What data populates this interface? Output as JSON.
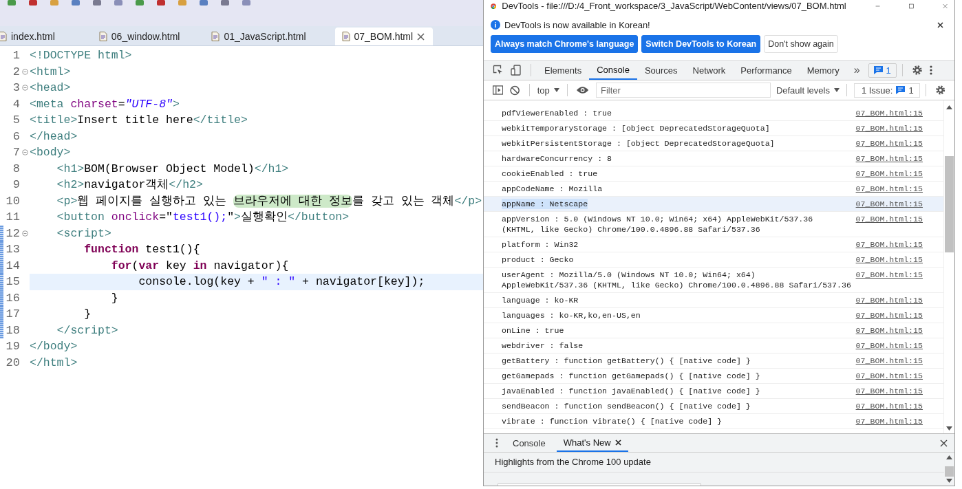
{
  "ide": {
    "editor_tabs": [
      {
        "label": "index.html",
        "selected": false,
        "closable": false
      },
      {
        "label": "06_window.html",
        "selected": false,
        "closable": false
      },
      {
        "label": "01_JavaScript.html",
        "selected": false,
        "closable": false
      },
      {
        "label": "07_BOM.html",
        "selected": true,
        "closable": true
      }
    ],
    "code_lines": [
      {
        "number": "1",
        "foldable": false,
        "changed": false,
        "current": false,
        "tokens": [
          {
            "kind": "tag",
            "text": "<!DOCTYPE html>"
          }
        ]
      },
      {
        "number": "2",
        "foldable": true,
        "changed": false,
        "current": false,
        "tokens": [
          {
            "kind": "tag",
            "text": "<html>"
          }
        ]
      },
      {
        "number": "3",
        "foldable": true,
        "changed": false,
        "current": false,
        "tokens": [
          {
            "kind": "tag",
            "text": "<head>"
          }
        ]
      },
      {
        "number": "4",
        "foldable": false,
        "changed": false,
        "current": false,
        "tokens": [
          {
            "kind": "tag",
            "text": "<meta "
          },
          {
            "kind": "attr",
            "text": "charset"
          },
          {
            "kind": "text",
            "text": "="
          },
          {
            "kind": "value",
            "text": "\"UTF-8\""
          },
          {
            "kind": "tag",
            "text": ">"
          }
        ]
      },
      {
        "number": "5",
        "foldable": false,
        "changed": false,
        "current": false,
        "tokens": [
          {
            "kind": "tag",
            "text": "<title>"
          },
          {
            "kind": "text",
            "text": "Insert title here"
          },
          {
            "kind": "tag",
            "text": "</title>"
          }
        ]
      },
      {
        "number": "6",
        "foldable": false,
        "changed": false,
        "current": false,
        "tokens": [
          {
            "kind": "tag",
            "text": "</head>"
          }
        ]
      },
      {
        "number": "7",
        "foldable": true,
        "changed": false,
        "current": false,
        "tokens": [
          {
            "kind": "tag",
            "text": "<body>"
          }
        ]
      },
      {
        "number": "8",
        "foldable": false,
        "changed": false,
        "current": false,
        "tokens": [
          {
            "kind": "tag",
            "text": "    <h1>"
          },
          {
            "kind": "text",
            "text": "BOM(Browser Object Model)"
          },
          {
            "kind": "tag",
            "text": "</h1>"
          }
        ]
      },
      {
        "number": "9",
        "foldable": false,
        "changed": false,
        "current": false,
        "tokens": [
          {
            "kind": "tag",
            "text": "    <h2>"
          },
          {
            "kind": "text",
            "text": "navigator객체"
          },
          {
            "kind": "tag",
            "text": "</h2>"
          }
        ]
      },
      {
        "number": "10",
        "foldable": false,
        "changed": false,
        "current": false,
        "tokens": [
          {
            "kind": "tag",
            "text": "    <p>"
          },
          {
            "kind": "text",
            "text": "웹 페이지를 실행하고 있는 "
          },
          {
            "kind": "match",
            "text": "브라우저에 대한 정보"
          },
          {
            "kind": "text",
            "text": "를 갖고 있는 객체"
          },
          {
            "kind": "tag",
            "text": "</p>"
          }
        ]
      },
      {
        "number": "11",
        "foldable": false,
        "changed": false,
        "current": false,
        "tokens": [
          {
            "kind": "tag",
            "text": "    <button "
          },
          {
            "kind": "attr",
            "text": "onclick"
          },
          {
            "kind": "text",
            "text": "=\""
          },
          {
            "kind": "string",
            "text": "test1();"
          },
          {
            "kind": "text",
            "text": "\""
          },
          {
            "kind": "tag",
            "text": ">"
          },
          {
            "kind": "text",
            "text": "실행확인"
          },
          {
            "kind": "tag",
            "text": "</button>"
          }
        ]
      },
      {
        "number": "12",
        "foldable": true,
        "changed": true,
        "current": false,
        "tokens": [
          {
            "kind": "tag",
            "text": "    <script>"
          }
        ]
      },
      {
        "number": "13",
        "foldable": false,
        "changed": true,
        "current": false,
        "tokens": [
          {
            "kind": "keyword",
            "text": "        function"
          },
          {
            "kind": "text",
            "text": " test1(){"
          }
        ]
      },
      {
        "number": "14",
        "foldable": false,
        "changed": true,
        "current": false,
        "tokens": [
          {
            "kind": "keyword",
            "text": "            for"
          },
          {
            "kind": "text",
            "text": "("
          },
          {
            "kind": "keyword",
            "text": "var"
          },
          {
            "kind": "text",
            "text": " key "
          },
          {
            "kind": "keyword",
            "text": "in"
          },
          {
            "kind": "text",
            "text": " navigator){"
          }
        ]
      },
      {
        "number": "15",
        "foldable": false,
        "changed": true,
        "current": true,
        "tokens": [
          {
            "kind": "text",
            "text": "                console.log(key + "
          },
          {
            "kind": "string",
            "text": "\" : \""
          },
          {
            "kind": "text",
            "text": " + navigator[key]);"
          }
        ]
      },
      {
        "number": "16",
        "foldable": false,
        "changed": true,
        "current": false,
        "tokens": [
          {
            "kind": "text",
            "text": "            }"
          }
        ]
      },
      {
        "number": "17",
        "foldable": false,
        "changed": true,
        "current": false,
        "tokens": [
          {
            "kind": "text",
            "text": "        }"
          }
        ]
      },
      {
        "number": "18",
        "foldable": false,
        "changed": true,
        "current": false,
        "tokens": [
          {
            "kind": "tag",
            "text": "    </script>"
          }
        ]
      },
      {
        "number": "19",
        "foldable": false,
        "changed": false,
        "current": false,
        "tokens": [
          {
            "kind": "tag",
            "text": "</body>"
          }
        ]
      },
      {
        "number": "20",
        "foldable": false,
        "changed": false,
        "current": false,
        "tokens": [
          {
            "kind": "tag",
            "text": "</html>"
          }
        ]
      }
    ]
  },
  "devtools": {
    "window_title": "DevTools - file:///D:/4_Front_workspace/3_JavaScript/WebContent/views/07_BOM.html",
    "infobar": {
      "message": "DevTools is now available in Korean!",
      "buttons": [
        {
          "label": "Always match Chrome's language",
          "kind": "primary"
        },
        {
          "label": "Switch DevTools to Korean",
          "kind": "primary"
        },
        {
          "label": "Don't show again",
          "kind": "secondary"
        }
      ]
    },
    "panel_tabs": [
      {
        "label": "Elements",
        "selected": false
      },
      {
        "label": "Console",
        "selected": true
      },
      {
        "label": "Sources",
        "selected": false
      },
      {
        "label": "Network",
        "selected": false
      },
      {
        "label": "Performance",
        "selected": false
      },
      {
        "label": "Memory",
        "selected": false
      }
    ],
    "more_tabs": "»",
    "issues_badge": "1",
    "console_toolbar": {
      "context": "top",
      "filter_placeholder": "Filter",
      "levels": "Default levels",
      "issues_label": "1 Issue:",
      "issues_count": "1"
    },
    "messages": [
      {
        "lines": [
          "pdfViewerEnabled : true"
        ],
        "source": "07_BOM.html:15",
        "selected": false
      },
      {
        "lines": [
          "webkitTemporaryStorage : [object DeprecatedStorageQuota]"
        ],
        "source": "07_BOM.html:15",
        "selected": false
      },
      {
        "lines": [
          "webkitPersistentStorage : [object DeprecatedStorageQuota]"
        ],
        "source": "07_BOM.html:15",
        "selected": false
      },
      {
        "lines": [
          "hardwareConcurrency : 8"
        ],
        "source": "07_BOM.html:15",
        "selected": false
      },
      {
        "lines": [
          "cookieEnabled : true"
        ],
        "source": "07_BOM.html:15",
        "selected": false
      },
      {
        "lines": [
          "appCodeName : Mozilla"
        ],
        "source": "07_BOM.html:15",
        "selected": false
      },
      {
        "lines": [
          "appName : Netscape"
        ],
        "source": "07_BOM.html:15",
        "selected": true
      },
      {
        "lines": [
          "appVersion : 5.0 (Windows NT 10.0; Win64; x64) AppleWebKit/537.36",
          "(KHTML, like Gecko) Chrome/100.0.4896.88 Safari/537.36"
        ],
        "source": "07_BOM.html:15",
        "selected": false
      },
      {
        "lines": [
          "platform : Win32"
        ],
        "source": "07_BOM.html:15",
        "selected": false
      },
      {
        "lines": [
          "product : Gecko"
        ],
        "source": "07_BOM.html:15",
        "selected": false
      },
      {
        "lines": [
          "userAgent : Mozilla/5.0 (Windows NT 10.0; Win64; x64)",
          "AppleWebKit/537.36 (KHTML, like Gecko) Chrome/100.0.4896.88 Safari/537.36"
        ],
        "source": "07_BOM.html:15",
        "selected": false
      },
      {
        "lines": [
          "language : ko-KR"
        ],
        "source": "07_BOM.html:15",
        "selected": false
      },
      {
        "lines": [
          "languages : ko-KR,ko,en-US,en"
        ],
        "source": "07_BOM.html:15",
        "selected": false
      },
      {
        "lines": [
          "onLine : true"
        ],
        "source": "07_BOM.html:15",
        "selected": false
      },
      {
        "lines": [
          "webdriver : false"
        ],
        "source": "07_BOM.html:15",
        "selected": false
      },
      {
        "lines": [
          "getBattery : function getBattery() { [native code] }"
        ],
        "source": "07_BOM.html:15",
        "selected": false
      },
      {
        "lines": [
          "getGamepads : function getGamepads() { [native code] }"
        ],
        "source": "07_BOM.html:15",
        "selected": false
      },
      {
        "lines": [
          "javaEnabled : function javaEnabled() { [native code] }"
        ],
        "source": "07_BOM.html:15",
        "selected": false
      },
      {
        "lines": [
          "sendBeacon : function sendBeacon() { [native code] }"
        ],
        "source": "07_BOM.html:15",
        "selected": false
      },
      {
        "lines": [
          "vibrate : function vibrate() { [native code] }"
        ],
        "source": "07_BOM.html:15",
        "selected": false
      }
    ],
    "drawer": {
      "tabs": [
        {
          "label": "Console",
          "selected": false,
          "closable": false
        },
        {
          "label": "What's New",
          "selected": true,
          "closable": true
        }
      ],
      "heading": "Highlights from the Chrome 100 update"
    }
  }
}
